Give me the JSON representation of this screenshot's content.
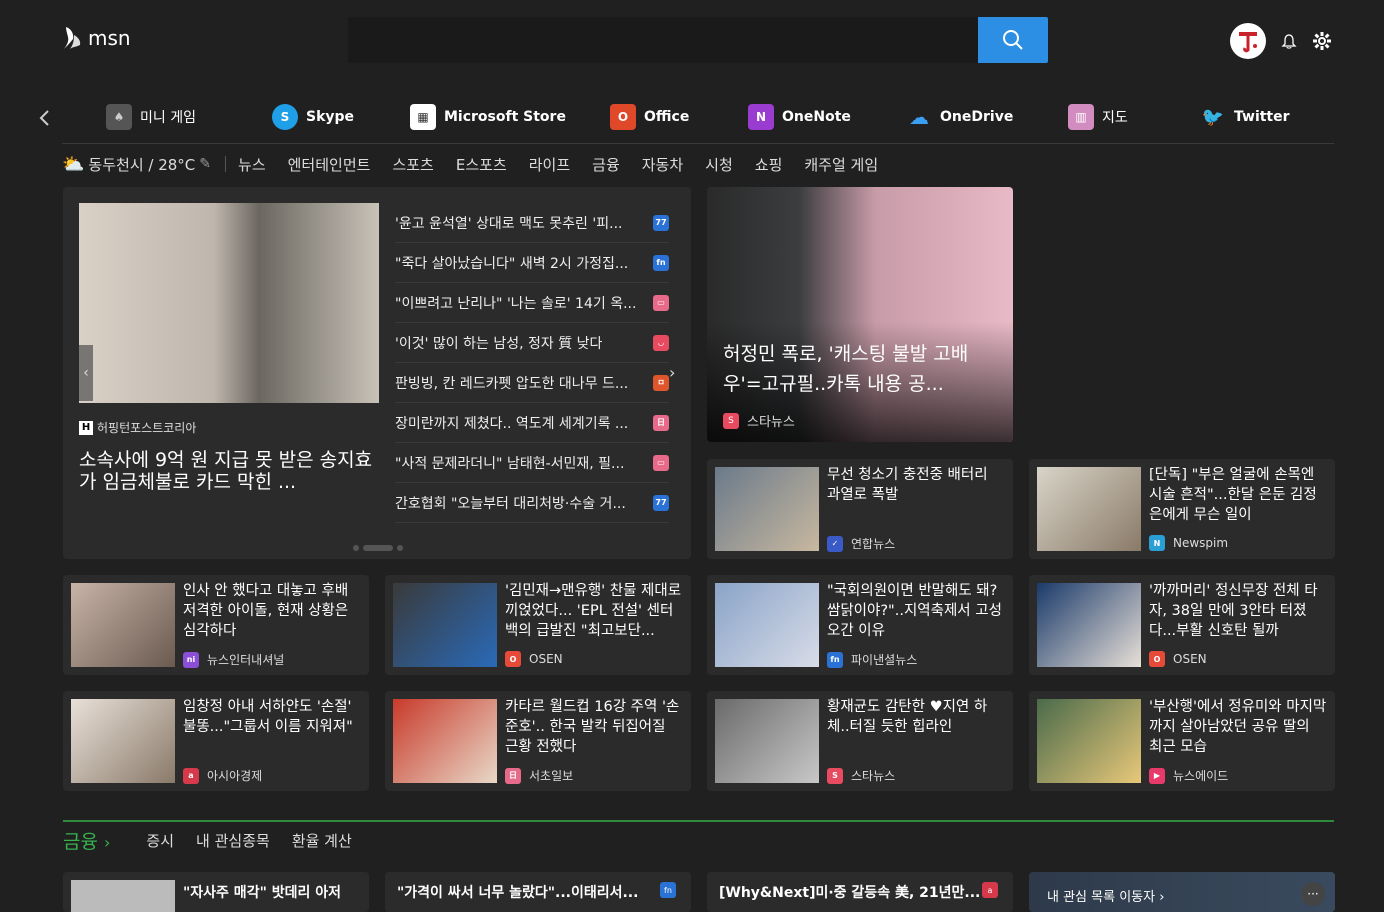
{
  "header": {
    "logo_text": "msn",
    "search": {
      "placeholder": "",
      "value": ""
    }
  },
  "apps": [
    {
      "label": "미니 게임",
      "icon": "cards-icon"
    },
    {
      "label": "Skype",
      "icon": "skype-icon"
    },
    {
      "label": "Microsoft Store",
      "icon": "store-icon"
    },
    {
      "label": "Office",
      "icon": "office-icon"
    },
    {
      "label": "OneNote",
      "icon": "onenote-icon"
    },
    {
      "label": "OneDrive",
      "icon": "onedrive-icon"
    },
    {
      "label": "지도",
      "icon": "maps-icon"
    },
    {
      "label": "Twitter",
      "icon": "twitter-icon"
    }
  ],
  "nav": {
    "weather": "동두천시 / 28°C",
    "items": [
      "뉴스",
      "엔터테인먼트",
      "스포츠",
      "E스포츠",
      "라이프",
      "금융",
      "자동차",
      "시청",
      "쇼핑",
      "캐주얼 게임"
    ]
  },
  "hero": {
    "source": "허핑턴포스트코리아",
    "title": "소속사에 9억 원 지급 못 받은 송지효가 임금체불로 카드 막힌 ...",
    "list": [
      {
        "text": "'윤고 윤석열' 상대로 맥도 못추린 '피...",
        "badge": "77",
        "color": "#2a72d6"
      },
      {
        "text": "\"죽다 살아났습니다\" 새벽 2시 가정집...",
        "badge": "fn",
        "color": "#2a72d6"
      },
      {
        "text": "\"이쁘려고 난리나\" '나는 솔로' 14기 옥...",
        "badge": "▭",
        "color": "#e86a8a"
      },
      {
        "text": "'이것' 많이 하는 남성, 정자 質 낮다",
        "badge": "◡",
        "color": "#e84a5f"
      },
      {
        "text": "판빙빙, 칸 레드카펫 압도한 대나무 드...",
        "badge": "ㅁ",
        "color": "#e0562c"
      },
      {
        "text": "장미란까지 제쳤다.. 역도계 세계기록 ...",
        "badge": "日",
        "color": "#e86a8a"
      },
      {
        "text": "\"사적 문제라더니\" 남태현-서민재, 필...",
        "badge": "▭",
        "color": "#e86a8a"
      },
      {
        "text": "간호협회 \"오늘부터 대리처방·수술 거...",
        "badge": "77",
        "color": "#2a72d6"
      }
    ]
  },
  "feature": {
    "title": "허정민 폭로, '캐스팅 불발 고배우'=고규필..카톡 내용 공...",
    "source": "스타뉴스"
  },
  "cards": [
    {
      "title": "무선 청소기 충전중 배터리 과열로 폭발",
      "source": "연합뉴스",
      "badge": "✓",
      "color": "#3a5bc7"
    },
    {
      "title": "[단독] \"부은 얼굴에 손목엔 시술 흔적\"...한달 은둔 김정은에게 무슨 일이",
      "source": "Newspim",
      "badge": "N",
      "color": "#2a9fd6"
    },
    {
      "title": "인사 안 했다고 대놓고 후배 저격한 아이돌, 현재 상황은 심각하다",
      "source": "뉴스인터내셔널",
      "badge": "ni",
      "color": "#8a4fd6"
    },
    {
      "title": "'김민재→맨유행' 찬물 제대로 끼얹었다... 'EPL 전설' 센터백의 급발진 \"최고보단...",
      "source": "OSEN",
      "badge": "O",
      "color": "#e84a3a"
    },
    {
      "title": "\"국회의원이면 반말해도 돼? 쌈닭이야?\"..지역축제서 고성 오간 이유",
      "source": "파이낸셜뉴스",
      "badge": "fn",
      "color": "#2a72d6"
    },
    {
      "title": "'까까머리' 정신무장 전체 타자, 38일 만에 3안타 터졌다...부활 신호탄 될까",
      "source": "OSEN",
      "badge": "O",
      "color": "#e84a3a"
    },
    {
      "title": "임창정 아내 서하얀도 '손절' 불똥...\"그룹서 이름 지워져\"",
      "source": "아시아경제",
      "badge": "a",
      "color": "#d63a4a"
    },
    {
      "title": "카타르 월드컵 16강 주역 '손준호'.. 한국 발칵 뒤집어질 근황 전했다",
      "source": "서초일보",
      "badge": "日",
      "color": "#e86a8a"
    },
    {
      "title": "황재균도 감탄한 ♥지연 하체..터질 듯한 힙라인",
      "source": "스타뉴스",
      "badge": "S",
      "color": "#e84a5f"
    },
    {
      "title": "'부산행'에서 정유미와 마지막까지 살아남았던 공유 딸의 최근 모습",
      "source": "뉴스에이드",
      "badge": "▶",
      "color": "#e83a6a"
    }
  ],
  "finance": {
    "heading": "금융",
    "items": [
      "증시",
      "내 관심종목",
      "환율 계산"
    ]
  },
  "bottom": [
    {
      "title": "\"자사주 매각\" 밧데리 아저"
    },
    {
      "title": "\"가격이 싸서 너무 놀랐다\"...이태리서..."
    },
    {
      "title": "[Why&Next]미·중 갈등속 美, 21년만..."
    },
    {
      "title": "내 관심 목록 이동자 ›"
    }
  ],
  "colors": {
    "accent": "#2d8fe4",
    "finance": "#36b24d",
    "bg": "#202020",
    "card": "#2b2b2b"
  }
}
